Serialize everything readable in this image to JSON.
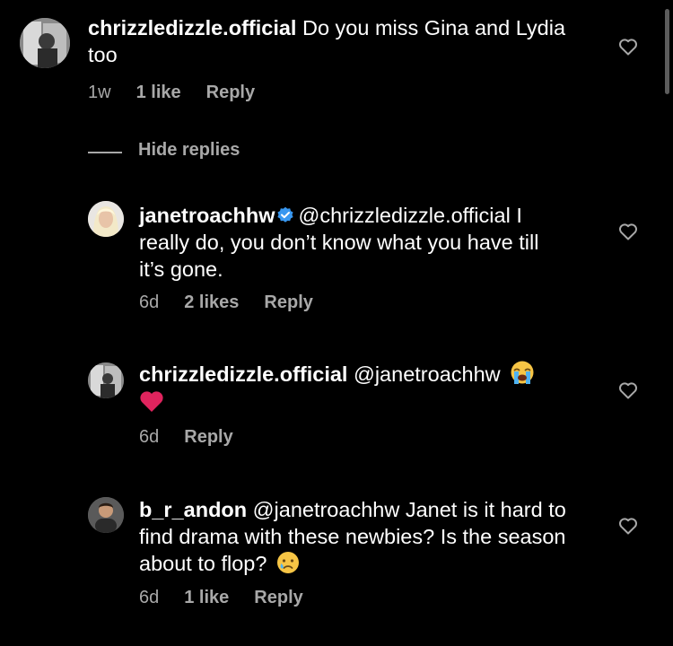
{
  "comments": [
    {
      "username": "chrizzledizzle.official",
      "text": " Do you miss Gina and Lydia too",
      "age": "1w",
      "likes": "1 like",
      "reply_label": "Reply",
      "avatar": "chrizzledizzle-avatar"
    },
    {
      "username": "janetroachhw",
      "verified": true,
      "mention": "@chrizzledizzle.official",
      "text": " I really do, you don’t know what you have till it’s gone.",
      "age": "6d",
      "likes": "2 likes",
      "reply_label": "Reply",
      "avatar": "janetroachhw-avatar"
    },
    {
      "username": "chrizzledizzle.official",
      "mention": "@janetroachhw",
      "emojis": [
        "loudly-crying-face-emoji",
        "red-heart-emoji"
      ],
      "age": "6d",
      "reply_label": "Reply",
      "avatar": "chrizzledizzle-avatar"
    },
    {
      "username": "b_r_andon",
      "mention": "@janetroachhw",
      "text": " Janet is it hard to find drama with these newbies? Is the season about to flop?",
      "emoji": "crying-face-emoji",
      "age": "6d",
      "likes": "1 like",
      "reply_label": "Reply",
      "avatar": "b_r_andon-avatar"
    }
  ],
  "hide_replies_label": "Hide replies",
  "colors": {
    "background": "#000000",
    "text": "#ffffff",
    "secondary": "#a8a8a8",
    "verified": "#3897f0",
    "heart_emoji": "#e0245e"
  }
}
